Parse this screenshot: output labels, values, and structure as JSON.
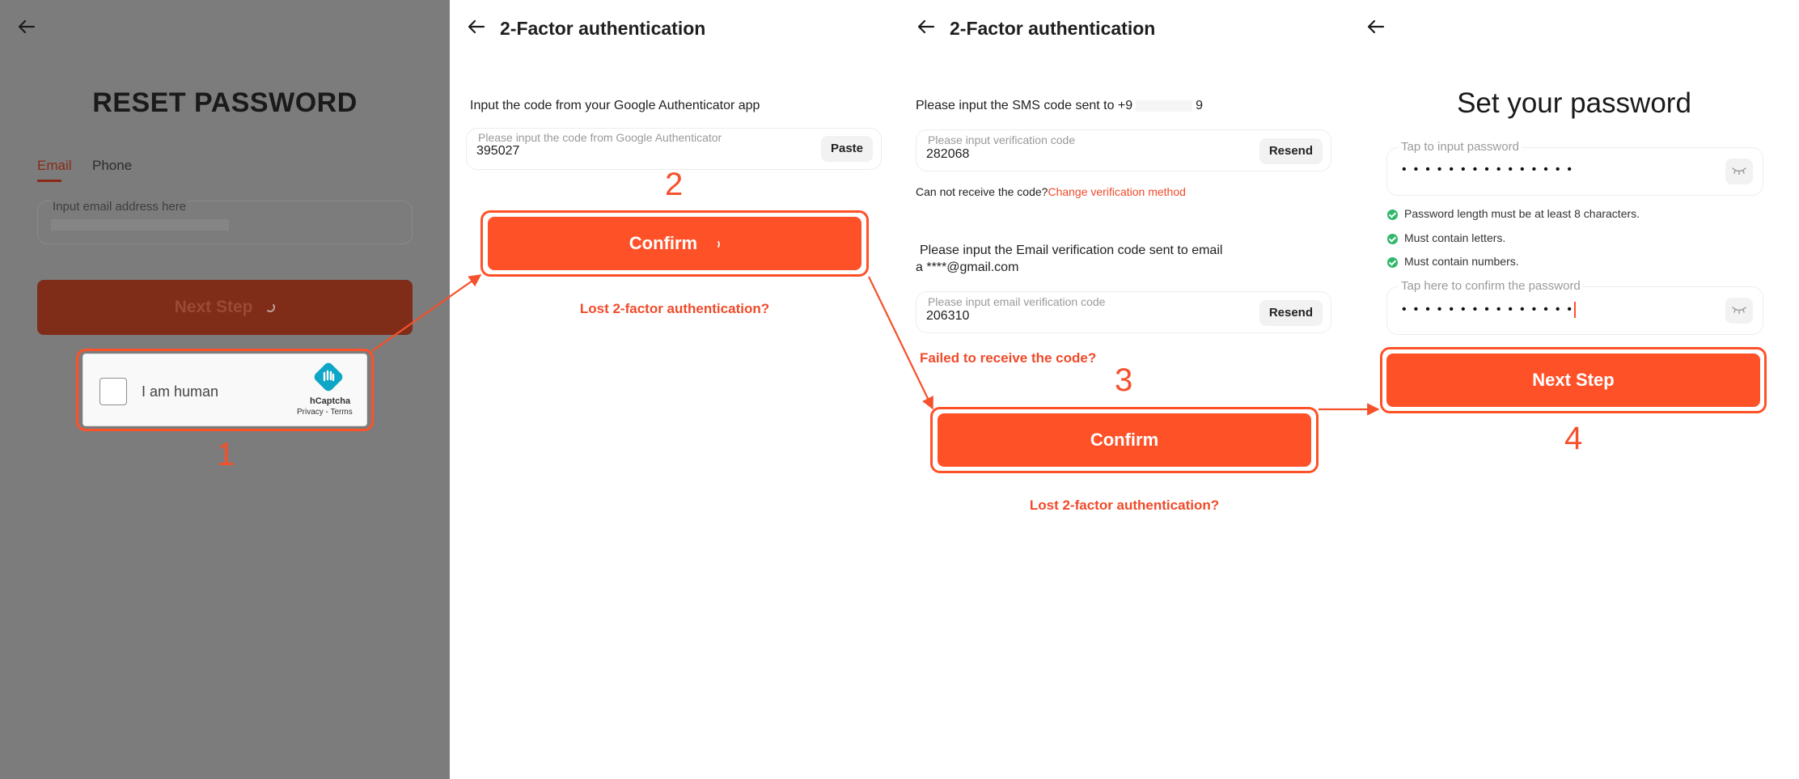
{
  "panel1": {
    "title": "RESET PASSWORD",
    "tabs": [
      {
        "label": "Email"
      },
      {
        "label": "Phone"
      }
    ],
    "email_placeholder": "Input email address here",
    "next_label": "Next Step",
    "captcha": {
      "label": "I am human",
      "brand": "hCaptcha",
      "links": "Privacy - Terms"
    },
    "step": "1"
  },
  "panel2": {
    "title": "2-Factor authentication",
    "instruction": "Input the code from your Google Authenticator app",
    "code_placeholder": "Please input the code from Google Authenticator",
    "code_value": "395027",
    "paste_label": "Paste",
    "confirm_label": "Confirm",
    "lost_link": "Lost 2-factor authentication?",
    "step": "2"
  },
  "panel3": {
    "title": "2-Factor authentication",
    "sms_prefix": "Please input the SMS code sent to +9",
    "sms_suffix": "9",
    "sms_placeholder": "Please input verification code",
    "sms_value": "282068",
    "resend_label": "Resend",
    "cannot_receive": "Can not receive the code?",
    "change_method": "Change verification method",
    "email_line1": "Please input the Email verification code sent to email",
    "email_line2": "a ****@gmail.com",
    "email_placeholder": "Please input email verification code",
    "email_value": "206310",
    "email_resend_label": "Resend",
    "failed_link": "Failed to receive the code?",
    "confirm_label": "Confirm",
    "lost_link": "Lost 2-factor authentication?",
    "step": "3"
  },
  "panel4": {
    "title": "Set your password",
    "password_label": "Tap to input password",
    "password_dots": "•••••••••••••••",
    "rules": [
      {
        "label": "Password length must be at least 8 characters."
      },
      {
        "label": "Must contain letters."
      },
      {
        "label": "Must contain numbers."
      }
    ],
    "confirm_label": "Tap here to confirm the password",
    "confirm_dots": "•••••••••••••••",
    "next_label": "Next Step",
    "step": "4"
  },
  "colors": {
    "accent": "#ff5128",
    "overlay": "#7c7c7c",
    "success": "#2fb76c"
  }
}
